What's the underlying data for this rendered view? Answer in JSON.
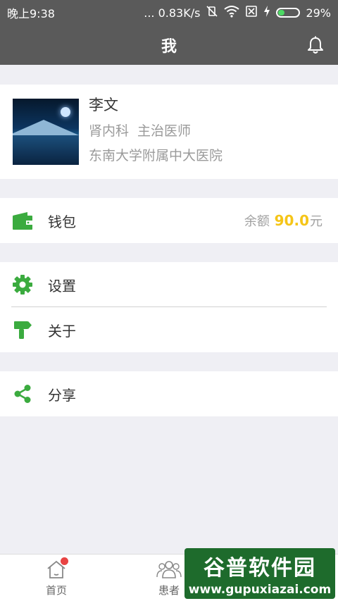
{
  "status_bar": {
    "time": "晚上9:38",
    "network_speed": "... 0.83K/s",
    "battery_percent": "29%",
    "battery_level": 0.29,
    "icons": [
      "vibrate-off-icon",
      "wifi-icon",
      "sim-none-icon",
      "charging-icon"
    ]
  },
  "header": {
    "title": "我",
    "bell_icon": "bell-icon"
  },
  "profile": {
    "name": "李文",
    "department": "肾内科",
    "position": "主治医师",
    "hospital": "东南大学附属中大医院"
  },
  "wallet": {
    "label": "钱包",
    "balance_prefix": "余额",
    "balance_amount": "90.0",
    "balance_unit": "元",
    "icon": "wallet-icon"
  },
  "menu": [
    {
      "label": "设置",
      "icon": "gear-icon"
    },
    {
      "label": "关于",
      "icon": "signpost-icon"
    }
  ],
  "share": {
    "label": "分享",
    "icon": "share-icon"
  },
  "bottom_nav": [
    {
      "label": "首页",
      "icon": "home-icon",
      "has_badge": true
    },
    {
      "label": "患者",
      "icon": "patients-icon",
      "has_badge": false
    }
  ],
  "watermark": {
    "title": "谷普软件园",
    "url": "www.gupuxiazai.com"
  },
  "colors": {
    "accent_green": "#3bab3f",
    "header_gray": "#5a5a5a",
    "balance_yellow": "#f5c518",
    "badge_red": "#e84343"
  }
}
